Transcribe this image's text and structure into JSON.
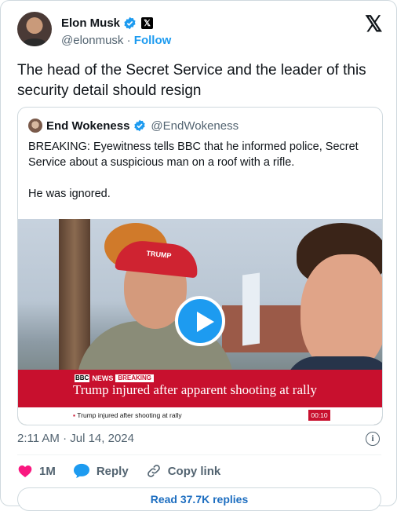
{
  "author": {
    "name": "Elon Musk",
    "handle": "@elonmusk",
    "separator": "·",
    "follow_label": "Follow"
  },
  "tweet": {
    "text": "The head of the Secret Service and the leader of this security detail should resign",
    "timestamp": "2:11 AM · Jul 14, 2024"
  },
  "quoted": {
    "name": "End Wokeness",
    "handle": "@EndWokeness",
    "paragraph1": "BREAKING: Eyewitness tells BBC that he informed police, Secret Service about a suspicious man on a roof with a rifle.",
    "paragraph2": "He was ignored.",
    "video": {
      "bbc_logo": "BBC",
      "news_label": "NEWS",
      "breaking_label": "BREAKING",
      "headline": "Trump injured after apparent shooting at rally",
      "ticker": "Trump injured after shooting at rally",
      "timecode": "00:10",
      "cap_text": "TRUMP"
    }
  },
  "actions": {
    "likes": "1M",
    "reply_label": "Reply",
    "copy_link_label": "Copy link"
  },
  "read_replies_label": "Read 37.7K replies",
  "colors": {
    "accent": "#1d9bf0",
    "like": "#f91880",
    "bbc_red": "#c8102e"
  }
}
